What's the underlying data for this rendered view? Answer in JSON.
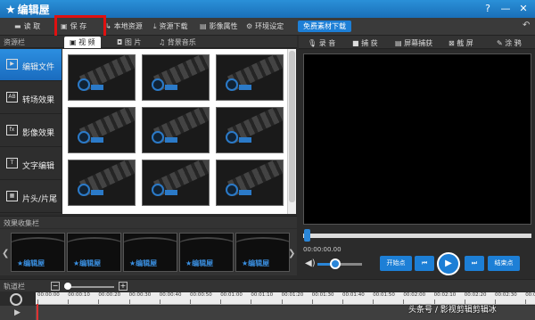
{
  "app": {
    "title": "编辑屋"
  },
  "window_controls": {
    "help": "?",
    "min": "—",
    "close": "✕"
  },
  "toolbar": {
    "read": "读 取",
    "save": "保 存",
    "local": "本地资源",
    "download": "资源下载",
    "props": "影像属性",
    "settings": "环境设定",
    "free": "免费素材下载"
  },
  "resource_panel": {
    "label": "资源栏",
    "tabs": [
      "视 频",
      "图 片",
      "背景音乐"
    ],
    "nav": [
      "编辑文件",
      "转场效果",
      "影像效果",
      "文字编辑",
      "片头/片尾"
    ],
    "nav_icons": [
      "video",
      "AB",
      "fx",
      "T",
      "film"
    ]
  },
  "effects": {
    "label": "效果收集栏",
    "logo_text": "编辑屋",
    "count": 5
  },
  "right_toolbar": {
    "record": "录 音",
    "capture": "捕 获",
    "screen_capture": "屏幕捕获",
    "screenshot": "截 屏",
    "doodle": "涂 鸦"
  },
  "playback": {
    "timecode": "00:00:00.00",
    "start": "开始点",
    "end": "结束点",
    "volume": 0.4
  },
  "track": {
    "label": "轨道栏",
    "ticks": [
      "00:00:00",
      "00:00:10",
      "00:00:20",
      "00:00:30",
      "00:00:40",
      "00:00:50",
      "00:01:00",
      "00:01:10",
      "00:01:20",
      "00:01:30",
      "00:01:40",
      "00:01:50",
      "00:02:00",
      "00:02:10",
      "00:02:20",
      "00:02:30",
      "00:02:40"
    ]
  },
  "watermark": "头条号 / 影视剪辑剪辑冰"
}
